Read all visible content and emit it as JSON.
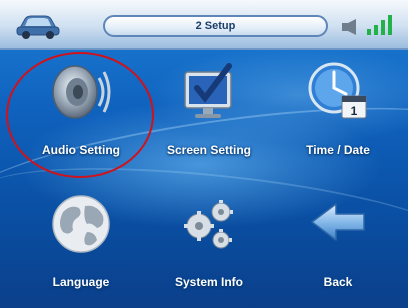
{
  "header": {
    "title": "2 Setup",
    "car_icon": "car-icon",
    "speaker_icon": "speaker-icon",
    "signal_icon": "signal-strength-icon"
  },
  "menu": {
    "items": [
      {
        "label": "Audio Setting",
        "icon": "speaker-cone-icon"
      },
      {
        "label": "Screen Setting",
        "icon": "monitor-check-icon"
      },
      {
        "label": "Time / Date",
        "icon": "clock-calendar-icon"
      },
      {
        "label": "Language",
        "icon": "globe-icon"
      },
      {
        "label": "System Info",
        "icon": "gears-icon"
      },
      {
        "label": "Back",
        "icon": "back-arrow-icon"
      }
    ]
  },
  "colors": {
    "background": "#0f62be",
    "highlight_ring": "#d0121a",
    "label_text": "#ffffff"
  }
}
